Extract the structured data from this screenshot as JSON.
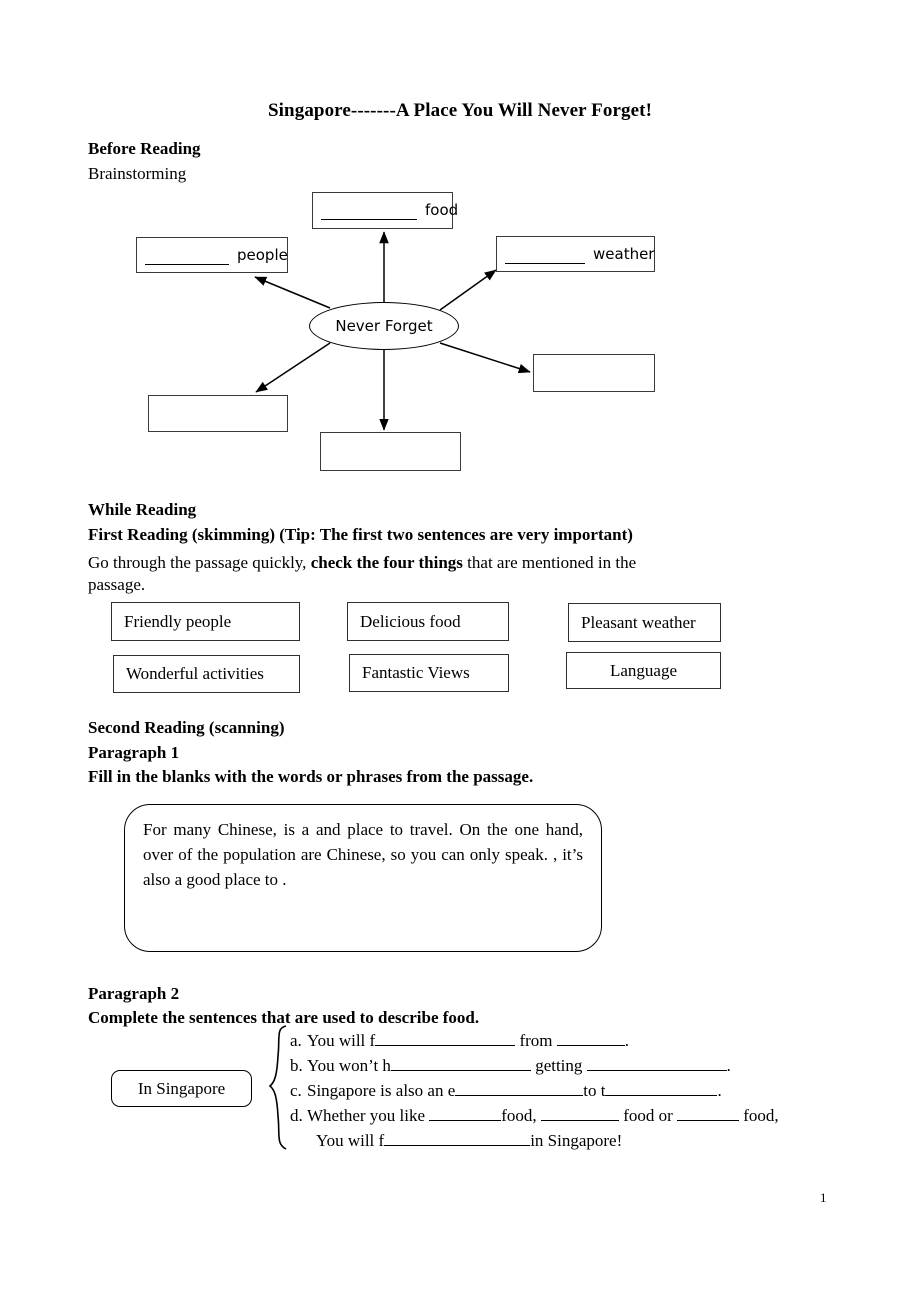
{
  "document": {
    "title": "Singapore-------A Place You Will Never Forget!",
    "page_number": "1"
  },
  "before_reading": {
    "heading": "Before Reading",
    "subheading": "Brainstorming"
  },
  "brainstorm": {
    "center_label": "Never Forget",
    "nodes": [
      {
        "id": "food",
        "blank": "__________",
        "label": "food"
      },
      {
        "id": "people",
        "blank": "_________",
        "label": "people"
      },
      {
        "id": "weather",
        "blank": "_________",
        "label": "weather"
      },
      {
        "id": "empty-right",
        "blank": "",
        "label": ""
      },
      {
        "id": "empty-bottom",
        "blank": "",
        "label": ""
      },
      {
        "id": "empty-left",
        "blank": "",
        "label": ""
      }
    ]
  },
  "while_reading": {
    "heading": "While Reading",
    "first_reading_heading": "First Reading (skimming) (Tip: The first two sentences are very important)",
    "instruction_part1": "Go through the passage quickly, ",
    "instruction_bold": "check the four things",
    "instruction_part2": " that are mentioned in the",
    "instruction_line2": "passage.",
    "options": [
      {
        "label": "Friendly people",
        "align": "left"
      },
      {
        "label": "Delicious food",
        "align": "left"
      },
      {
        "label": "Pleasant weather",
        "align": "left"
      },
      {
        "label": "Wonderful activities",
        "align": "left"
      },
      {
        "label": "Fantastic Views",
        "align": "left"
      },
      {
        "label": "Language",
        "align": "center"
      }
    ]
  },
  "second_reading": {
    "heading": "Second Reading (scanning)",
    "paragraph1_heading": "Paragraph 1",
    "paragraph1_instruction": "Fill in the blanks with the words or phrases from the passage.",
    "paragraph1_text": {
      "s1": "For many Chinese,",
      "s2": "is a",
      "s3": "and",
      "s4": "place to travel. On the one hand, over",
      "s5": "of the population are Chinese, so you can only speak",
      "s6": ".",
      "s7": ", it’s also a good place to",
      "s8": "."
    },
    "paragraph2_heading": "Paragraph 2",
    "paragraph2_instruction": "Complete the sentences that are used to describe food.",
    "brace_label": "In Singapore",
    "sentences": [
      {
        "marker": "a.",
        "text_parts": [
          "You will f",
          " from ",
          "."
        ]
      },
      {
        "marker": "b.",
        "text_parts": [
          "You won’t h",
          " getting ",
          "."
        ]
      },
      {
        "marker": "c.",
        "text_parts": [
          "Singapore is also an e",
          "to t",
          "."
        ]
      },
      {
        "marker": "d.",
        "text_parts": [
          "Whether you like ",
          "food, ",
          " food or ",
          " food,"
        ]
      },
      {
        "marker": "",
        "text_parts": [
          "You will f",
          "in Singapore!"
        ]
      }
    ]
  },
  "colors": {
    "text": "#000000",
    "box_border": "#2f2f2f",
    "diagram_border": "#3a3a3a",
    "background": "#ffffff"
  }
}
